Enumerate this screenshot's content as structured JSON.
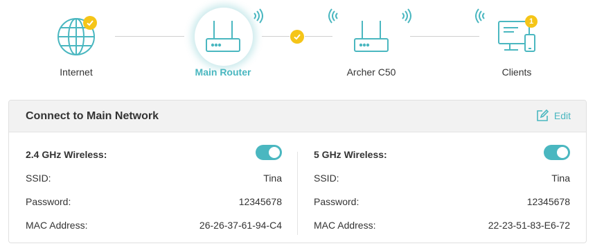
{
  "topology": {
    "nodes": [
      {
        "label": "Internet",
        "icon": "globe-icon",
        "status": "connected"
      },
      {
        "label": "Main Router",
        "icon": "router-icon",
        "status": "selected"
      },
      {
        "label": "Archer C50",
        "icon": "router-icon",
        "status": "normal"
      },
      {
        "label": "Clients",
        "icon": "clients-icon",
        "badge_count": "1"
      }
    ]
  },
  "panel": {
    "title": "Connect to Main Network",
    "edit_label": "Edit",
    "band_24": {
      "label": "2.4 GHz Wireless:",
      "enabled": true,
      "ssid_label": "SSID:",
      "ssid": "Tina",
      "password_label": "Password:",
      "password": "12345678",
      "mac_label": "MAC Address:",
      "mac": "26-26-37-61-94-C4"
    },
    "band_5": {
      "label": "5 GHz Wireless:",
      "enabled": true,
      "ssid_label": "SSID:",
      "ssid": "Tina",
      "password_label": "Password:",
      "password": "12345678",
      "mac_label": "MAC Address:",
      "mac": "22-23-51-83-E6-72"
    }
  },
  "colors": {
    "accent": "#4ab7c0",
    "badge": "#f5c518",
    "line": "#cfcfcf"
  }
}
